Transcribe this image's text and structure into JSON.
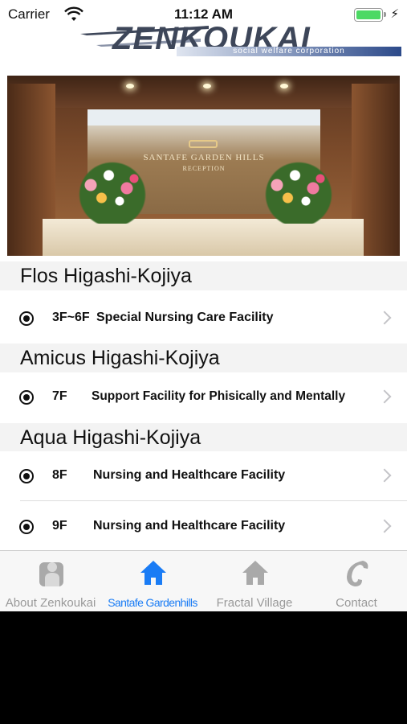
{
  "status_bar": {
    "carrier": "Carrier",
    "time": "11:12 AM",
    "wifi_icon": "wifi-icon",
    "battery_icon": "battery-icon",
    "charging_icon": "charging-bolt-icon"
  },
  "header": {
    "logo_name": "ZENKOUKAI",
    "logo_subtitle": "social welfare corporation"
  },
  "hero": {
    "sign_title": "SANTAFE GARDEN HILLS",
    "sign_subtitle": "RECEPTION"
  },
  "sections": [
    {
      "title": "Flos Higashi-Kojiya",
      "rows": [
        {
          "floor": "3F~6F",
          "label": "Special Nursing Care Facility"
        }
      ]
    },
    {
      "title": "Amicus Higashi-Kojiya",
      "rows": [
        {
          "floor": "7F",
          "label": "Support Facility for Phisically and Mentally"
        }
      ]
    },
    {
      "title": "Aqua Higashi-Kojiya",
      "rows": [
        {
          "floor": "8F",
          "label": "Nursing and Healthcare Facility"
        },
        {
          "floor": "9F",
          "label": "Nursing and Healthcare Facility"
        }
      ]
    }
  ],
  "tabs": [
    {
      "label": "About Zenkoukai",
      "icon": "person-icon",
      "active": false
    },
    {
      "label": "Santafe Gardenhills",
      "icon": "home-icon",
      "active": true
    },
    {
      "label": "Fractal Village",
      "icon": "home-icon",
      "active": false
    },
    {
      "label": "Contact",
      "icon": "phone-icon",
      "active": false
    }
  ],
  "colors": {
    "accent": "#1a7cf5",
    "inactive_tab": "#999999",
    "section_header_bg": "#f3f3f3"
  }
}
